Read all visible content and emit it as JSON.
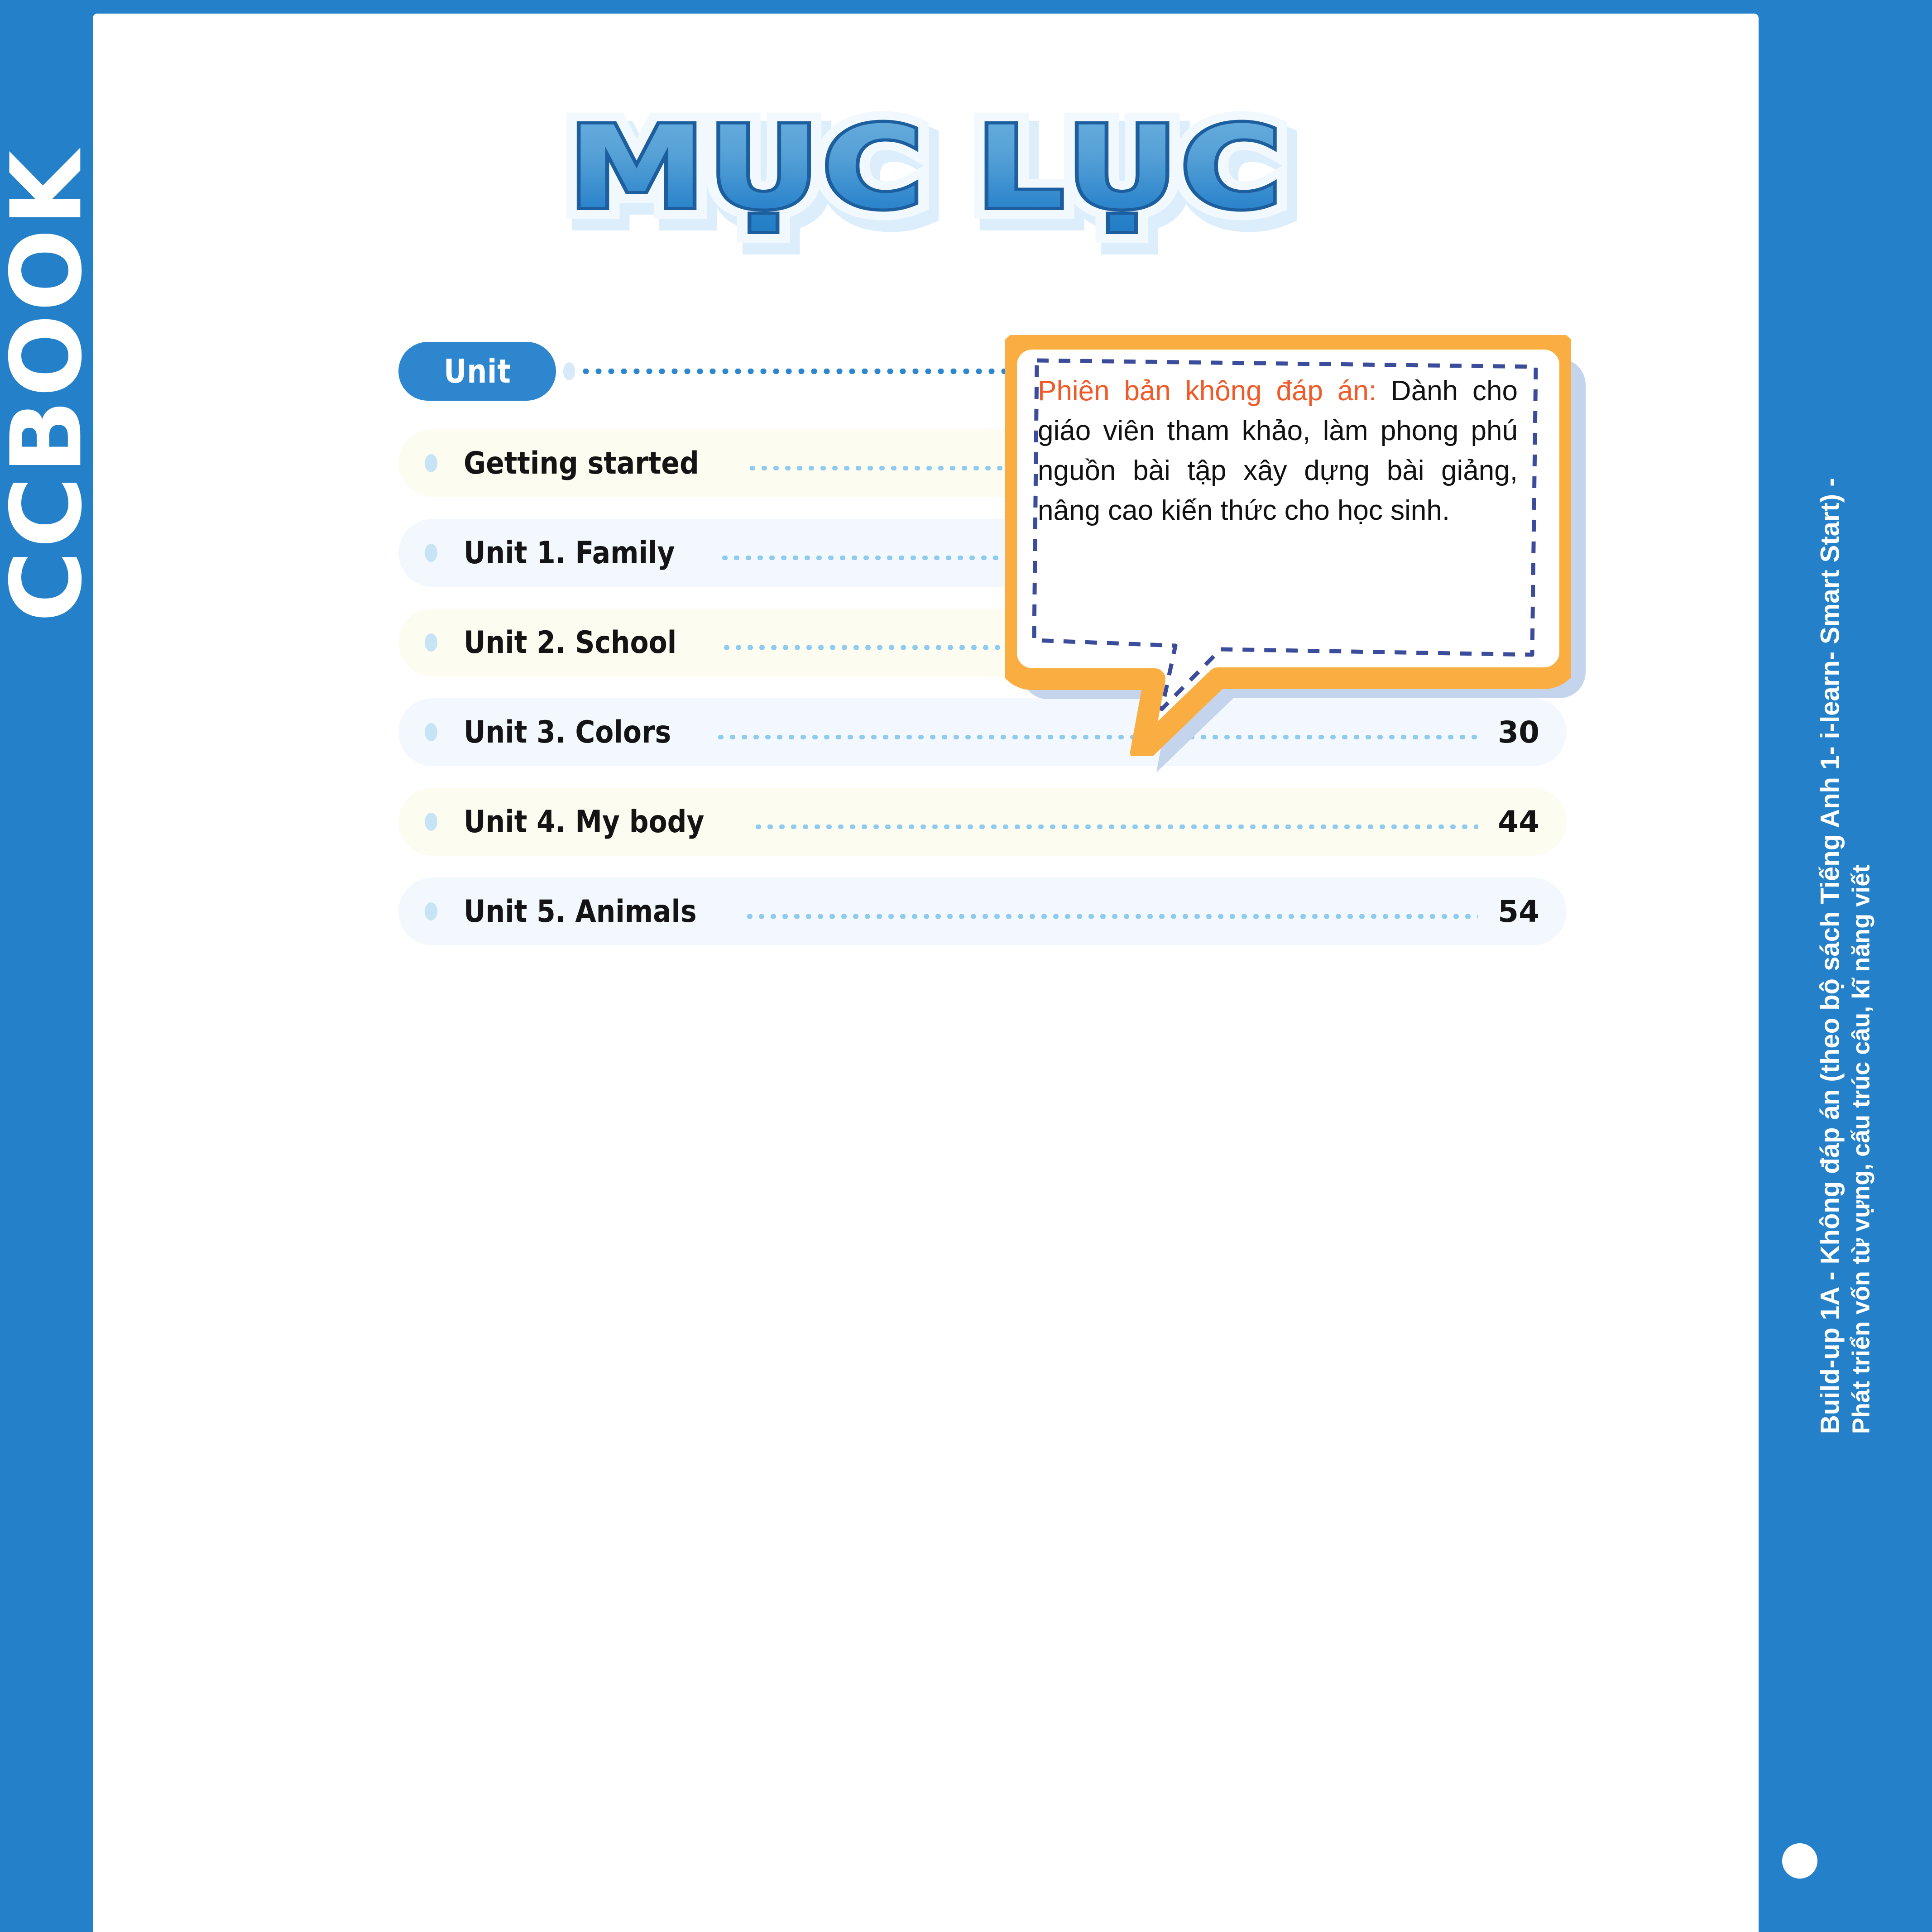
{
  "brand": {
    "logo_text": "CCBOOK"
  },
  "title": {
    "text": "MỤC LỤC"
  },
  "toc": {
    "header": {
      "label": "Unit"
    },
    "rows": [
      {
        "label": "Getting started",
        "page": ""
      },
      {
        "label": "Unit 1. Family",
        "page": ""
      },
      {
        "label": "Unit 2. School",
        "page": ""
      },
      {
        "label": "Unit 3. Colors",
        "page": "30"
      },
      {
        "label": "Unit 4. My body",
        "page": "44"
      },
      {
        "label": "Unit 5. Animals",
        "page": "54"
      }
    ]
  },
  "callout": {
    "lead": "Phiên bản không đáp án:",
    "body": " Dành cho giáo viên tham khảo, làm phong phú nguồn bài tập xây dựng bài giảng, nâng cao kiến thức cho học sinh."
  },
  "spine": {
    "line1": "Build-up 1A - Không đáp án (theo bộ sách Tiếng Anh 1- i-learn- Smart Start) -",
    "line2": "Phát triển vốn từ vựng, cấu trúc câu, kĩ năng viết"
  },
  "colors": {
    "brand_blue": "#2480C8",
    "pill_blue": "#2E87CE",
    "accent_orange": "#FAAE42",
    "callout_lead": "#F05A28",
    "row_cream": "#FDFCF0",
    "row_blue": "#F2F8FD",
    "bubble_shadow": "#C3D4EC",
    "dash_border": "#3B4C9B"
  }
}
